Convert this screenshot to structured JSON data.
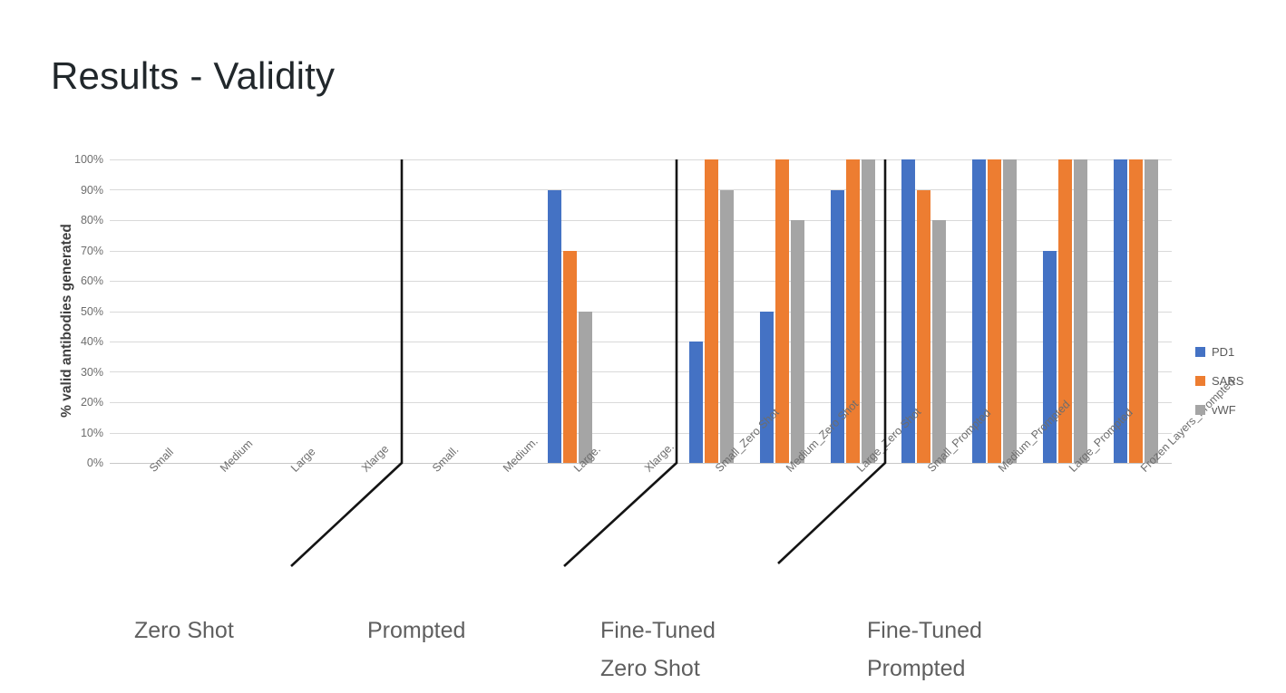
{
  "slide": {
    "title": "Results - Validity"
  },
  "legend": {
    "position": "right",
    "entries": [
      {
        "label": "PD1",
        "color": "#4472c4"
      },
      {
        "label": "SARS",
        "color": "#ed7d31"
      },
      {
        "label": "vWF",
        "color": "#a5a5a5"
      }
    ]
  },
  "group_captions": [
    {
      "text": "Zero Shot"
    },
    {
      "text": "Prompted"
    },
    {
      "text": "Fine-Tuned\nZero Shot"
    },
    {
      "text": "Fine-Tuned\nPrompted"
    }
  ],
  "chart_data": {
    "type": "bar",
    "title": "",
    "xlabel": "",
    "ylabel": "% valid antibodies generated",
    "ylim": [
      0,
      100
    ],
    "ytick_labels": [
      "100%",
      "90%",
      "80%",
      "70%",
      "60%",
      "50%",
      "40%",
      "30%",
      "20%",
      "10%",
      "0%"
    ],
    "ytick_values": [
      100,
      90,
      80,
      70,
      60,
      50,
      40,
      30,
      20,
      10,
      0
    ],
    "grid": true,
    "categories": [
      "Small",
      "Medium",
      "Large",
      "Xlarge",
      "Small.",
      "Medium.",
      "Large.",
      "Xlarge.",
      "Small_Zero Shot",
      "Medium_Zero Shot",
      "Large_Zero Shot",
      "Small_Prompted",
      "Medium_Prompted",
      "Large_Prompted",
      "Frozen Layers_Prompted"
    ],
    "series": [
      {
        "name": "PD1",
        "color": "#4472c4",
        "values": [
          0,
          0,
          0,
          0,
          0,
          0,
          90,
          0,
          40,
          50,
          90,
          100,
          100,
          70,
          100
        ]
      },
      {
        "name": "SARS",
        "color": "#ed7d31",
        "values": [
          0,
          0,
          0,
          0,
          0,
          0,
          70,
          0,
          100,
          100,
          100,
          90,
          100,
          100,
          100
        ]
      },
      {
        "name": "vWF",
        "color": "#a5a5a5",
        "values": [
          0,
          0,
          0,
          0,
          0,
          0,
          50,
          0,
          90,
          80,
          100,
          80,
          100,
          100,
          100
        ]
      }
    ],
    "group_spans": [
      {
        "caption": "Zero Shot",
        "categories": [
          "Small",
          "Medium",
          "Large",
          "Xlarge"
        ]
      },
      {
        "caption": "Prompted",
        "categories": [
          "Small.",
          "Medium.",
          "Large.",
          "Xlarge."
        ]
      },
      {
        "caption": "Fine-Tuned Zero Shot",
        "categories": [
          "Small_Zero Shot",
          "Medium_Zero Shot",
          "Large_Zero Shot"
        ]
      },
      {
        "caption": "Fine-Tuned Prompted",
        "categories": [
          "Small_Prompted",
          "Medium_Prompted",
          "Large_Prompted",
          "Frozen Layers_Prompted"
        ]
      }
    ]
  }
}
